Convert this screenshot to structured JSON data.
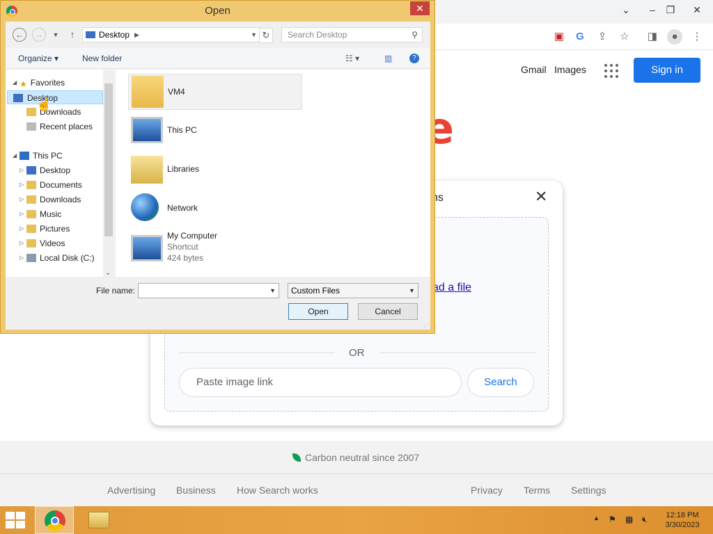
{
  "chrome": {
    "header_links": {
      "gmail": "Gmail",
      "images": "Images"
    },
    "signin_label": "Sign in",
    "logo_fragment": "e",
    "window_controls": [
      "⌄",
      "–",
      "❐",
      "✕"
    ]
  },
  "lens": {
    "title_fragment": "ns",
    "upload_fragment": "ad a file",
    "or_label": "OR",
    "paste_placeholder": "Paste image link",
    "search_label": "Search"
  },
  "footer": {
    "carbon": "Carbon neutral since 2007",
    "links_left": [
      "Advertising",
      "Business",
      "How Search works"
    ],
    "links_right": [
      "Privacy",
      "Terms",
      "Settings"
    ]
  },
  "dialog": {
    "title": "Open",
    "address_location": "Desktop",
    "search_placeholder": "Search Desktop",
    "organize_label": "Organize ▾",
    "new_folder_label": "New folder",
    "favorites_label": "Favorites",
    "favorites": [
      "Desktop",
      "Downloads",
      "Recent places"
    ],
    "this_pc_label": "This PC",
    "this_pc_children": [
      "Desktop",
      "Documents",
      "Downloads",
      "Music",
      "Pictures",
      "Videos",
      "Local Disk (C:)"
    ],
    "files": [
      {
        "name": "VM4"
      },
      {
        "name": "This PC"
      },
      {
        "name": "Libraries"
      },
      {
        "name": "Network"
      },
      {
        "name": "My Computer",
        "type": "Shortcut",
        "size": "424 bytes"
      }
    ],
    "file_name_label": "File name:",
    "file_name_value": "",
    "file_type_value": "Custom Files",
    "open_label": "Open",
    "cancel_label": "Cancel"
  },
  "taskbar": {
    "time": "12:18 PM",
    "date": "3/30/2023"
  },
  "colors": {
    "dialog_frame": "#f0c870",
    "taskbar": "#e9a344",
    "google_blue": "#1a73e8"
  }
}
